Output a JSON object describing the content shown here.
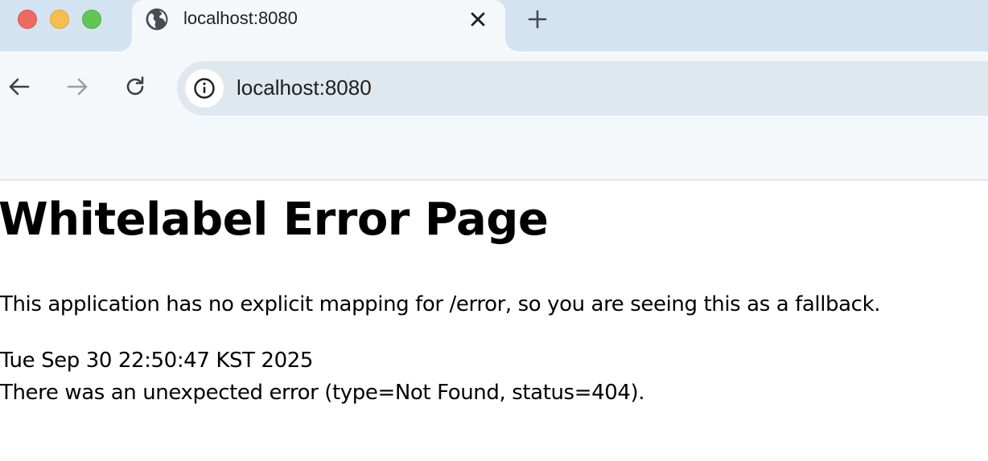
{
  "browser": {
    "tab": {
      "title": "localhost:8080",
      "favicon": "globe-icon"
    },
    "window_controls": {
      "close": "#ee6a5f",
      "minimize": "#f5be4f",
      "maximize": "#62c655"
    },
    "omnibox": {
      "url": "localhost:8080",
      "site_info_icon": "info-icon"
    },
    "nav_icons": [
      "back-arrow-icon",
      "forward-arrow-icon",
      "reload-icon"
    ],
    "colors": {
      "tabstrip": "#d3e3f1",
      "active_tab": "#f5f8fb",
      "omnibox": "#dfe8ef"
    }
  },
  "page": {
    "heading": "Whitelabel Error Page",
    "message": "This application has no explicit mapping for /error, so you are seeing this as a fallback.",
    "timestamp": "Tue Sep 30 22:50:47 KST 2025",
    "error": "There was an unexpected error (type=Not Found, status=404)."
  }
}
